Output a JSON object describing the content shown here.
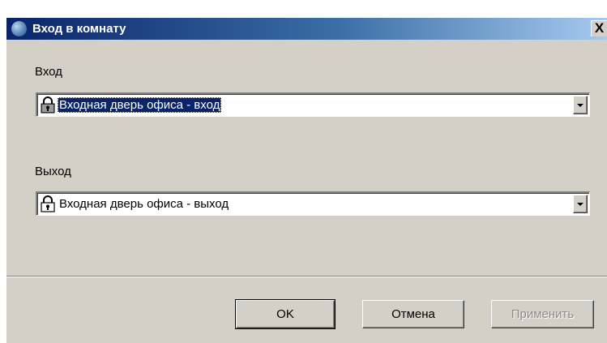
{
  "window": {
    "title": "Вход в комнату",
    "close_symbol": "X",
    "icon": "app-globe-icon"
  },
  "entry": {
    "label": "Вход",
    "selected_value": "Входная дверь офиса - вход",
    "icon": "lock-icon",
    "focused": true
  },
  "exit": {
    "label": "Выход",
    "selected_value": "Входная дверь офиса - выход",
    "icon": "lock-icon"
  },
  "buttons": {
    "ok": "OK",
    "cancel": "Отмена",
    "apply": "Применить",
    "apply_disabled": true
  },
  "colors": {
    "dialog_bg": "#d4d0c8",
    "titlebar_start": "#0a246a",
    "titlebar_end": "#a6caf0",
    "selection": "#0a246a"
  }
}
